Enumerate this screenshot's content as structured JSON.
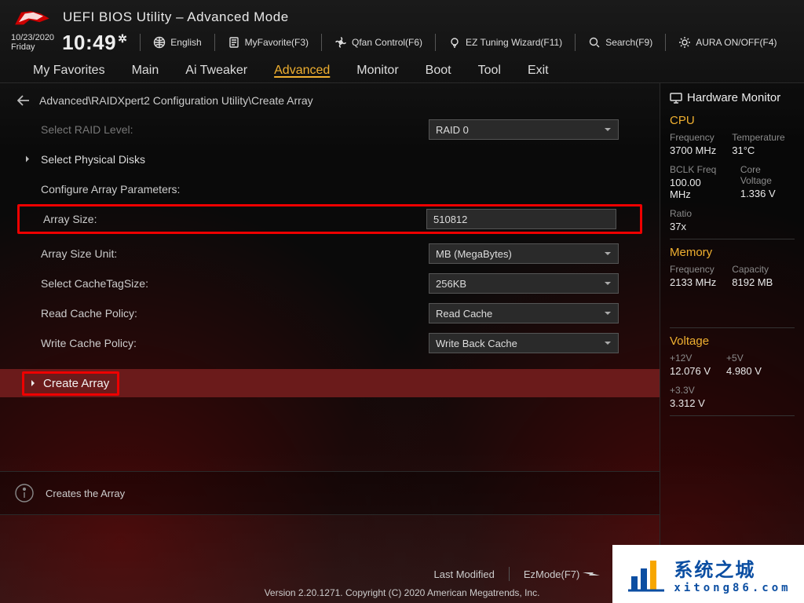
{
  "header": {
    "title": "UEFI BIOS Utility – Advanced Mode",
    "date": "10/23/2020",
    "day": "Friday",
    "time": "10:49",
    "toolbar": {
      "language": "English",
      "myfavorite": "MyFavorite(F3)",
      "qfan": "Qfan Control(F6)",
      "eztune": "EZ Tuning Wizard(F11)",
      "search": "Search(F9)",
      "aura": "AURA ON/OFF(F4)"
    }
  },
  "tabs": [
    "My Favorites",
    "Main",
    "Ai Tweaker",
    "Advanced",
    "Monitor",
    "Boot",
    "Tool",
    "Exit"
  ],
  "active_tab": "Advanced",
  "breadcrumb": "Advanced\\RAIDXpert2 Configuration Utility\\Create Array",
  "form": {
    "select_raid_level": {
      "label": "Select RAID Level:",
      "value": "RAID 0"
    },
    "select_physical_disks": {
      "label": "Select Physical Disks"
    },
    "configure_label": "Configure Array Parameters:",
    "array_size": {
      "label": "Array Size:",
      "value": "510812"
    },
    "array_size_unit": {
      "label": "Array Size Unit:",
      "value": "MB (MegaBytes)"
    },
    "cache_tag_size": {
      "label": "Select CacheTagSize:",
      "value": "256KB"
    },
    "read_cache_policy": {
      "label": "Read Cache Policy:",
      "value": "Read Cache"
    },
    "write_cache_policy": {
      "label": "Write Cache Policy:",
      "value": "Write Back Cache"
    },
    "create_array": "Create Array"
  },
  "help": "Creates the Array",
  "bottom": {
    "last_modified": "Last Modified",
    "ezmode": "EzMode(F7)",
    "version": "Version 2.20.1271. Copyright (C) 2020 American Megatrends, Inc."
  },
  "sidebar": {
    "title": "Hardware Monitor",
    "cpu": {
      "heading": "CPU",
      "frequency": {
        "k": "Frequency",
        "v": "3700 MHz"
      },
      "temperature": {
        "k": "Temperature",
        "v": "31°C"
      },
      "bclk": {
        "k": "BCLK Freq",
        "v": "100.00 MHz"
      },
      "core_voltage": {
        "k": "Core Voltage",
        "v": "1.336 V"
      },
      "ratio": {
        "k": "Ratio",
        "v": "37x"
      }
    },
    "memory": {
      "heading": "Memory",
      "frequency": {
        "k": "Frequency",
        "v": "2133 MHz"
      },
      "capacity": {
        "k": "Capacity",
        "v": "8192 MB"
      }
    },
    "voltage": {
      "heading": "Voltage",
      "p12v": {
        "k": "+12V",
        "v": "12.076 V"
      },
      "p5v": {
        "k": "+5V",
        "v": "4.980 V"
      },
      "p33v": {
        "k": "+3.3V",
        "v": "3.312 V"
      }
    }
  },
  "watermark": {
    "big": "系统之城",
    "url": "xitong86.com"
  }
}
